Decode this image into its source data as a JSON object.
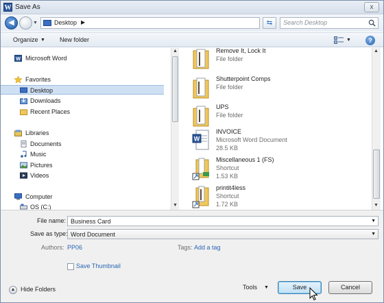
{
  "window": {
    "title": "Save As",
    "app_icon_letter": "W",
    "close_glyph": "x"
  },
  "address": {
    "location": "Desktop",
    "chevron": "▶",
    "search_placeholder": "Search Desktop"
  },
  "toolbar": {
    "organize_label": "Organize",
    "new_folder_label": "New folder"
  },
  "nav": {
    "items": [
      {
        "label": "Microsoft Word",
        "icon": "word-icon"
      },
      {
        "label": "Favorites",
        "icon": "star-icon"
      },
      {
        "label": "Desktop",
        "icon": "desktop-icon",
        "selected": true
      },
      {
        "label": "Downloads",
        "icon": "downloads-icon"
      },
      {
        "label": "Recent Places",
        "icon": "recent-places-icon"
      },
      {
        "label": "Libraries",
        "icon": "libraries-icon"
      },
      {
        "label": "Documents",
        "icon": "documents-icon"
      },
      {
        "label": "Music",
        "icon": "music-icon"
      },
      {
        "label": "Pictures",
        "icon": "pictures-icon"
      },
      {
        "label": "Videos",
        "icon": "videos-icon"
      },
      {
        "label": "Computer",
        "icon": "computer-icon"
      },
      {
        "label": "OS (C:)",
        "icon": "drive-icon"
      }
    ]
  },
  "files": [
    {
      "name": "Remove It, Lock It",
      "type": "File folder",
      "size": "",
      "icon": "folder-icon"
    },
    {
      "name": "Shutterpoint Comps",
      "type": "File folder",
      "size": "",
      "icon": "folder-icon"
    },
    {
      "name": "UPS",
      "type": "File folder",
      "size": "",
      "icon": "folder-icon"
    },
    {
      "name": "INVOICE",
      "type": "Microsoft Word Document",
      "size": "28.5 KB",
      "icon": "word-document-icon"
    },
    {
      "name": "Miscellaneous 1 (FS)",
      "type": "Shortcut",
      "size": "1.53 KB",
      "icon": "folder-shortcut-icon"
    },
    {
      "name": "printit4less",
      "type": "Shortcut",
      "size": "1.72 KB",
      "icon": "folder-shortcut-icon"
    }
  ],
  "form": {
    "filename_label": "File name:",
    "filename_value": "Business Card",
    "savetype_label": "Save as type:",
    "savetype_value": "Word Document",
    "authors_label": "Authors:",
    "authors_value": "PP06",
    "tags_label": "Tags:",
    "tags_value": "Add a tag",
    "thumbnail_label": "Save Thumbnail",
    "thumbnail_checked": false
  },
  "footer": {
    "hide_folders_label": "Hide Folders",
    "tools_label": "Tools",
    "save_label": "Save",
    "cancel_label": "Cancel"
  },
  "colors": {
    "accent_link": "#2a66b3",
    "selection": "#cfe0f3",
    "folder": "#f1c75a"
  }
}
